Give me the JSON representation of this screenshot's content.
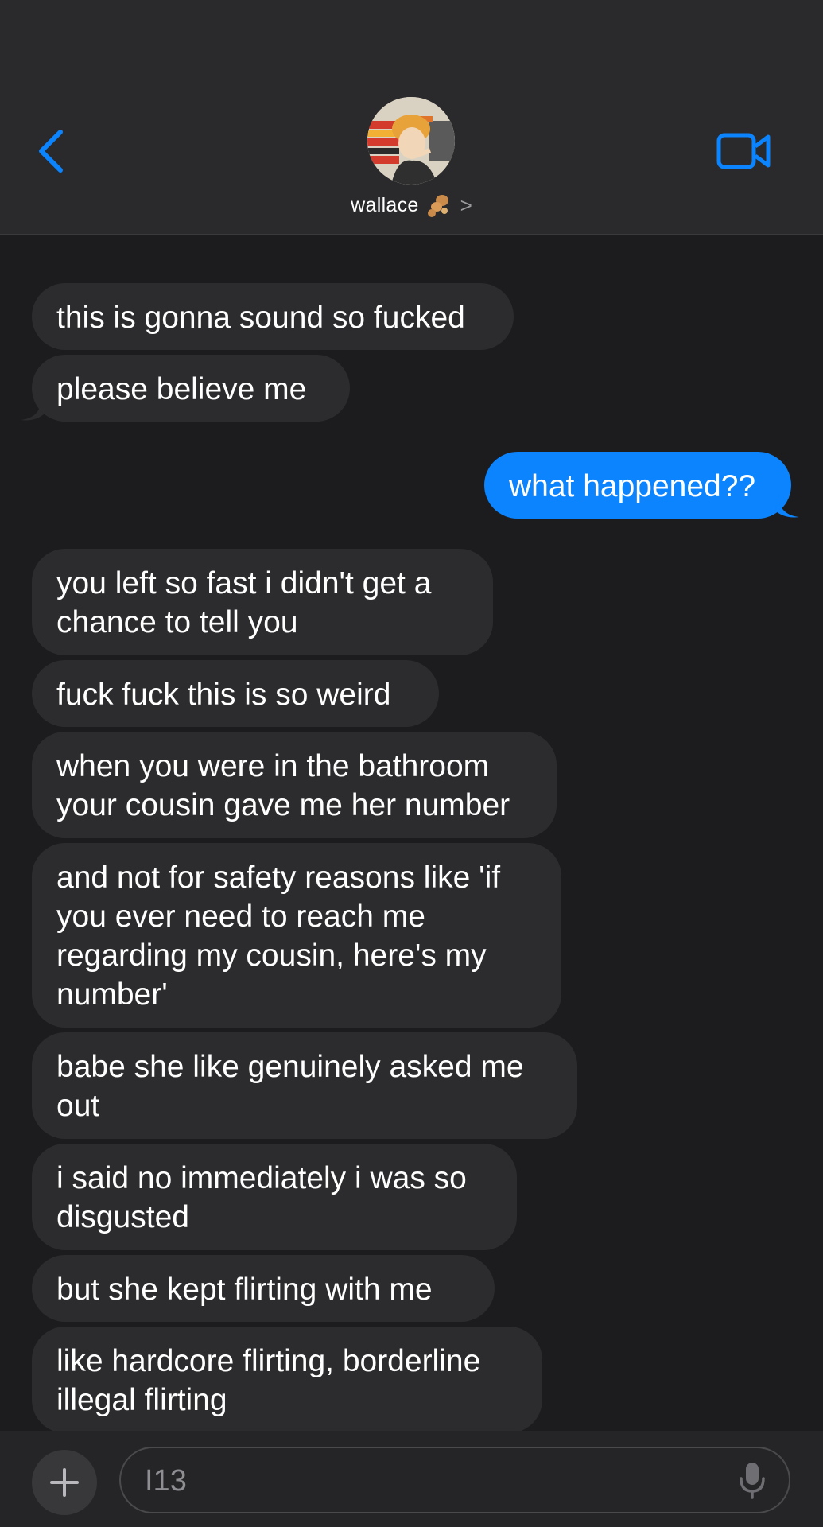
{
  "header": {
    "contact_name": "wallace",
    "chevron": ">",
    "back_icon": "chevron-left-icon",
    "video_icon": "video-camera-icon",
    "accent_color": "#0b84fe"
  },
  "messages": [
    {
      "direction": "incoming",
      "text": "this is gonna sound so fucked"
    },
    {
      "direction": "incoming",
      "text": "please believe me"
    },
    {
      "direction": "outgoing",
      "text": "what happened??"
    },
    {
      "direction": "incoming",
      "text": "you left so fast i didn't get a\nchance to tell you"
    },
    {
      "direction": "incoming",
      "text": "fuck fuck this is so weird"
    },
    {
      "direction": "incoming",
      "text": "when you were in the bathroom\nyour cousin gave me her number"
    },
    {
      "direction": "incoming",
      "text": "and not for safety reasons like 'if\nyou ever need to reach me\nregarding my cousin, here's my\nnumber'"
    },
    {
      "direction": "incoming",
      "text": "babe she like genuinely asked me\nout"
    },
    {
      "direction": "incoming",
      "text": "i said no immediately i was so\ndisgusted"
    },
    {
      "direction": "incoming",
      "text": "but she kept flirting with me"
    },
    {
      "direction": "incoming",
      "text": "like hardcore flirting, borderline\nillegal flirting"
    }
  ],
  "composer": {
    "value": "I13",
    "placeholder": "",
    "plus_icon": "plus-icon",
    "mic_icon": "microphone-icon"
  },
  "colors": {
    "incoming_bubble": "#2c2c2e",
    "outgoing_bubble": "#0b84fe",
    "background": "#1c1c1e",
    "header_background": "#2a2a2c"
  }
}
